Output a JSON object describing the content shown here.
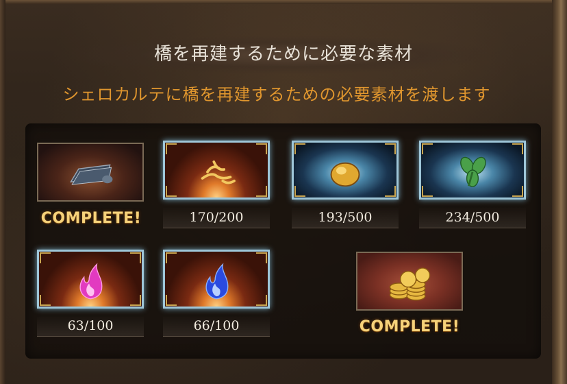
{
  "header": {
    "title": "橋を再建するために必要な素材",
    "subtitle": "シェロカルテに橋を再建するための必要素材を渡します"
  },
  "materials": [
    {
      "icon": "scroll-icon",
      "status": "COMPLETE!"
    },
    {
      "icon": "golden-branch-icon",
      "progress": "170/200"
    },
    {
      "icon": "golden-nut-icon",
      "progress": "193/500"
    },
    {
      "icon": "green-leaf-icon",
      "progress": "234/500"
    },
    {
      "icon": "pink-flame-icon",
      "progress": "63/100"
    },
    {
      "icon": "blue-flame-icon",
      "progress": "66/100"
    },
    {
      "icon": "gold-coins-icon",
      "status": "COMPLETE!"
    }
  ],
  "colors": {
    "subtitle": "#e0962e",
    "complete_text": "#f6d27a",
    "card_glow": "#9ec6d8"
  }
}
